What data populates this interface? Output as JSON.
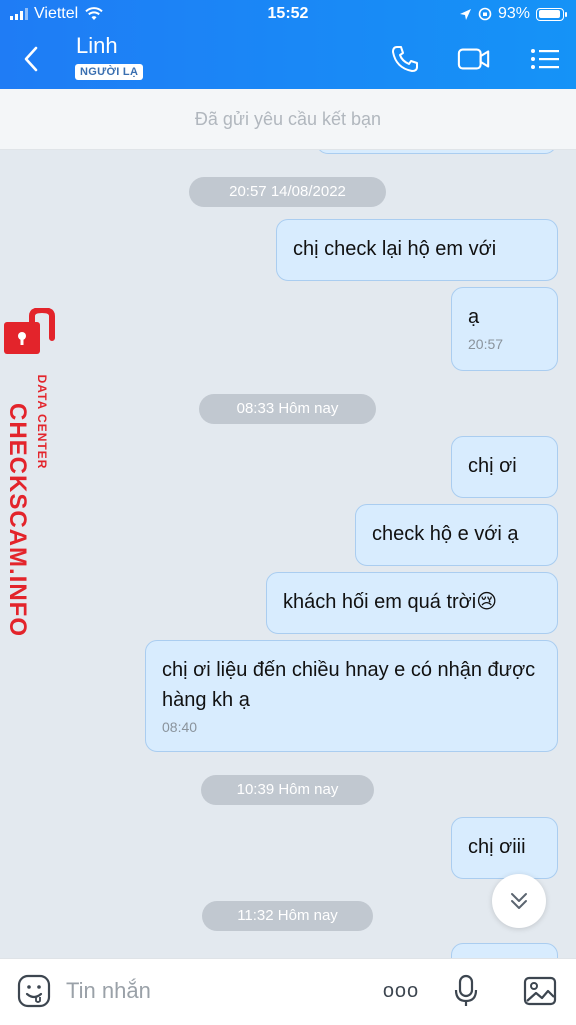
{
  "status_bar": {
    "carrier": "Viettel",
    "time": "15:52",
    "battery": "93%"
  },
  "header": {
    "contact_name": "Linh",
    "contact_tag": "NGƯỜI LẠ"
  },
  "banner": {
    "text": "Đã gửi yêu cầu kết bạn"
  },
  "messages": {
    "ts1": "20:57 14/08/2022",
    "m1": "chị check lại hộ em với",
    "m2": "ạ",
    "m2_time": "20:57",
    "ts2": "08:33 Hôm nay",
    "m3": "chị ơi",
    "m4": "check hộ e với ạ",
    "m5": "khách hối em quá trời😢",
    "m6": "chị ơi liệu đến chiều hnay e có nhận được hàng kh ạ",
    "m6_time": "08:40",
    "ts3": "10:39 Hôm nay",
    "m7": "chị ơiii",
    "ts4": "11:32 Hôm nay"
  },
  "watermark": {
    "brand": "CHECKSCAM.INFO",
    "subtitle": "DATA CENTER"
  },
  "input": {
    "placeholder": "Tin nhắn",
    "more_label": "ooo"
  },
  "colors": {
    "header": "#1f7cf5",
    "bubble_out": "#d8ecfe",
    "bubble_border": "#aacdf0",
    "watermark": "#e3242b"
  }
}
